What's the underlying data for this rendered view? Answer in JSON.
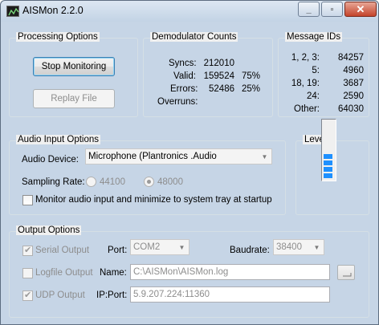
{
  "window": {
    "title": "AISMon 2.2.0"
  },
  "processing": {
    "title": "Processing Options",
    "stop_label": "Stop Monitoring",
    "replay_label": "Replay File"
  },
  "demod": {
    "title": "Demodulator Counts",
    "syncs_label": "Syncs:",
    "syncs_value": "212010",
    "valid_label": "Valid:",
    "valid_value": "159524",
    "valid_pct": "75%",
    "errors_label": "Errors:",
    "errors_value": "52486",
    "errors_pct": "25%",
    "overruns_label": "Overruns:"
  },
  "message_ids": {
    "title": "Message IDs",
    "rows": [
      {
        "label": "1, 2, 3:",
        "value": "84257"
      },
      {
        "label": "5:",
        "value": "4960"
      },
      {
        "label": "18, 19:",
        "value": "3687"
      },
      {
        "label": "24:",
        "value": "2590"
      },
      {
        "label": "Other:",
        "value": "64030"
      }
    ]
  },
  "audio": {
    "title": "Audio Input Options",
    "device_label": "Audio Device:",
    "device_value": "Microphone (Plantronics .Audio",
    "rate_label": "Sampling Rate:",
    "rate_options": [
      "44100",
      "48000"
    ],
    "rate_selected": "48000",
    "monitor_label": "Monitor audio input and minimize to system tray at startup",
    "monitor_checked": false
  },
  "level": {
    "title": "Level",
    "level_fraction": 0.35,
    "segments_lit": 4
  },
  "output": {
    "title": "Output Options",
    "serial_label": "Serial Output",
    "serial_checked": true,
    "port_label": "Port:",
    "port_value": "COM2",
    "baud_label": "Baudrate:",
    "baud_value": "38400",
    "logfile_label": "Logfile Output",
    "logfile_checked": false,
    "name_label": "Name:",
    "name_value": "C:\\AISMon\\AISMon.log",
    "udp_label": "UDP Output",
    "udp_checked": true,
    "ipport_label": "IP:Port:",
    "ipport_value": "5.9.207.224:11360"
  },
  "colors": {
    "level_fill": "#1e90ff",
    "title_bar": "#c6d5e6"
  }
}
